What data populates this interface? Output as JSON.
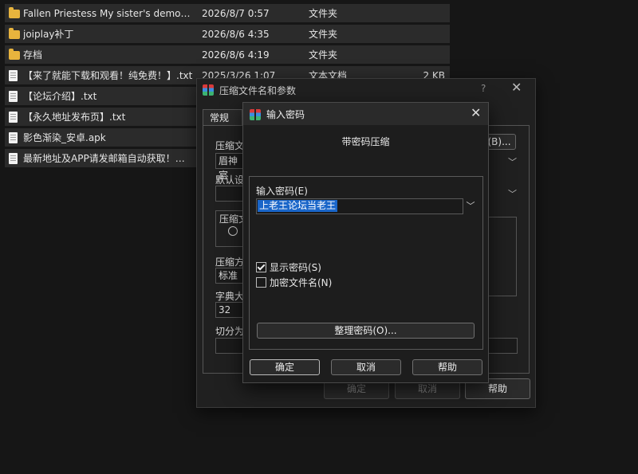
{
  "files": [
    {
      "name": "Fallen Priestess My sister's demonic ...",
      "date": "2026/8/7 0:57",
      "type": "文件夹",
      "size": "",
      "kind": "folder"
    },
    {
      "name": "joiplay补丁",
      "date": "2026/8/6 4:35",
      "type": "文件夹",
      "size": "",
      "kind": "folder"
    },
    {
      "name": "存档",
      "date": "2026/8/6 4:19",
      "type": "文件夹",
      "size": "",
      "kind": "folder"
    },
    {
      "name": "【来了就能下载和观看！纯免费！】.txt",
      "date": "2025/3/26 1:07",
      "type": "文本文档",
      "size": "2 KB",
      "kind": "doc"
    },
    {
      "name": "【论坛介绍】.txt",
      "date": "",
      "type": "",
      "size": "",
      "kind": "doc"
    },
    {
      "name": "【永久地址发布页】.txt",
      "date": "",
      "type": "",
      "size": "",
      "kind": "doc"
    },
    {
      "name": "影色渐染_安卓.apk",
      "date": "",
      "type": "",
      "size": "",
      "kind": "doc"
    },
    {
      "name": "最新地址及APP请发邮箱自动获取！！！...",
      "date": "",
      "type": "",
      "size": "",
      "kind": "doc"
    }
  ],
  "back_dialog": {
    "title": "压缩文件名和参数",
    "help_glyph": "?",
    "close_glyph": "✕",
    "tab_general": "常规",
    "label_archive_name": "压缩文",
    "field_archive_name": "眉神官",
    "browse_label": "(B)...",
    "label_default": "默认设",
    "label_format": "压缩文",
    "label_method": "压缩方",
    "field_method": "标准",
    "label_dict": "字典大",
    "field_dict": "32",
    "label_split": "切分为",
    "ok_label": "确定",
    "cancel_label": "取消",
    "help_label": "帮助"
  },
  "password_dialog": {
    "title": "输入密码",
    "close_glyph": "✕",
    "subtitle": "带密码压缩",
    "password_label": "输入密码(E)",
    "password_value": "上老王论坛当老王",
    "dropdown_glyph": "﹀",
    "show_password_label": "显示密码(S)",
    "show_password_checked": true,
    "encrypt_names_label": "加密文件名(N)",
    "encrypt_names_checked": false,
    "manage_label": "整理密码(O)...",
    "ok_label": "确定",
    "cancel_label": "取消",
    "help_label": "帮助"
  }
}
